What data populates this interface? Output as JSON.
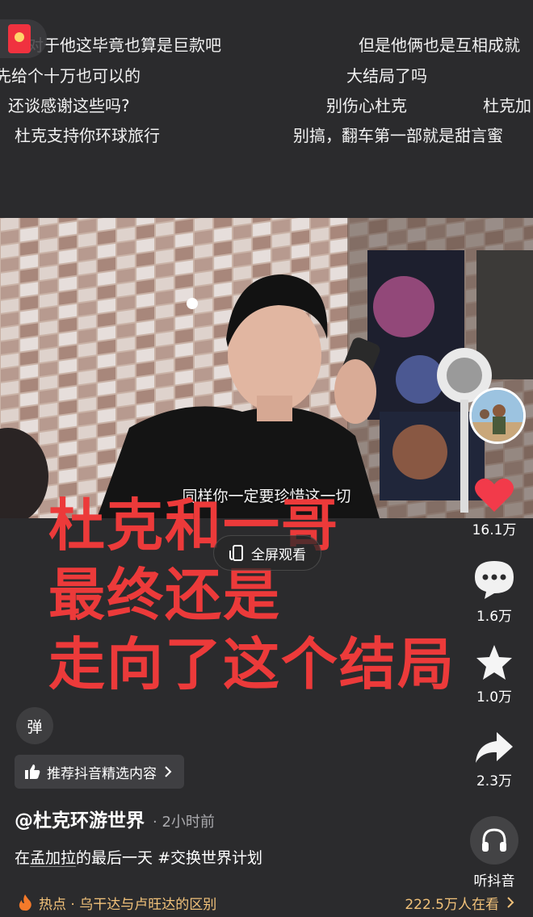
{
  "danmaku": [
    "对于他这毕竟也算是巨款吧",
    "但是他俩也是互相成就",
    "先给个十万也可以的",
    "大结局了吗",
    "还谈感谢这些吗?",
    "别伤心杜克",
    "杜克加",
    "杜克支持你环球旅行",
    "别搞，翻车第一部就是甜言蜜"
  ],
  "video": {
    "subtitle": "同样你一定要珍惜这一切"
  },
  "overlay_title": [
    "杜克和一哥",
    "最终还是",
    "走向了这个结局"
  ],
  "fullscreen": {
    "label": "全屏观看"
  },
  "rail": {
    "like_count": "16.1万",
    "comment_count": "1.6万",
    "favorite_count": "1.0万",
    "share_count": "2.3万",
    "listen_label": "听抖音"
  },
  "danmu_toggle": "弹",
  "recommend": {
    "label": "推荐抖音精选内容"
  },
  "author": {
    "name": "@杜克环游世界",
    "time": "· 2小时前"
  },
  "description": {
    "prefix": "在",
    "place": "孟加拉",
    "rest": "的最后一天 #交换世界计划"
  },
  "hotbar": {
    "topic": "热点 · 乌干达与卢旺达的区别",
    "viewers": "222.5万人在看"
  },
  "colors": {
    "background": "#2b2b2d",
    "title_red": "#ec3a3a",
    "like_red": "#f23a4a",
    "hot_gold": "#f2c27a"
  }
}
